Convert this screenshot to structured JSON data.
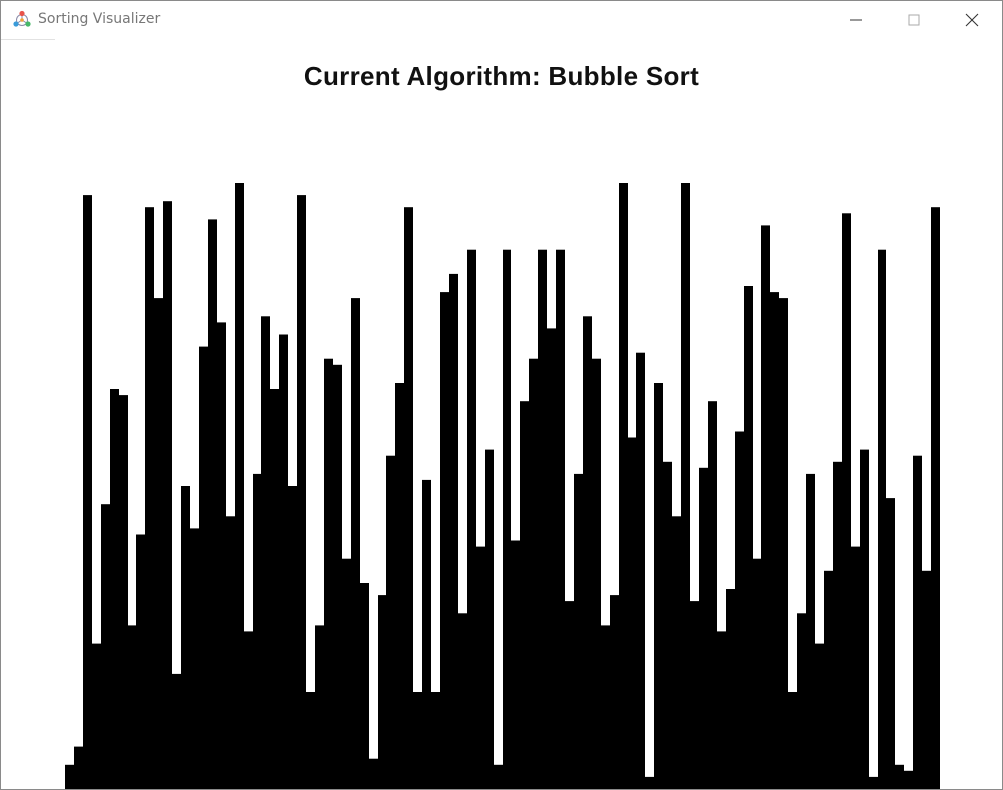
{
  "window": {
    "title": "Sorting Visualizer"
  },
  "header": {
    "algorithm_label": "Current Algorithm: Bubble Sort"
  },
  "colors": {
    "bar": "#000000",
    "background": "#ffffff",
    "title_text": "#777777"
  },
  "icons": {
    "app": "sorting-visualizer-logo-icon",
    "minimize": "minimize-icon",
    "maximize": "maximize-icon",
    "close": "close-icon"
  },
  "chart_data": {
    "type": "bar",
    "title": "Current Algorithm: Bubble Sort",
    "ylim": [
      0,
      100
    ],
    "values": [
      4,
      7,
      98,
      24,
      47,
      66,
      65,
      27,
      42,
      96,
      81,
      97,
      19,
      50,
      43,
      73,
      94,
      77,
      45,
      100,
      26,
      52,
      78,
      66,
      75,
      50,
      98,
      16,
      27,
      71,
      70,
      38,
      81,
      34,
      5,
      32,
      55,
      67,
      96,
      16,
      51,
      16,
      82,
      85,
      29,
      89,
      40,
      56,
      4,
      89,
      41,
      64,
      71,
      89,
      76,
      89,
      31,
      52,
      78,
      71,
      27,
      32,
      100,
      58,
      72,
      2,
      67,
      54,
      45,
      100,
      31,
      53,
      64,
      26,
      33,
      59,
      83,
      38,
      93,
      82,
      81,
      16,
      29,
      52,
      24,
      36,
      54,
      95,
      40,
      56,
      2,
      89,
      48,
      4,
      3,
      55,
      36,
      96
    ]
  }
}
